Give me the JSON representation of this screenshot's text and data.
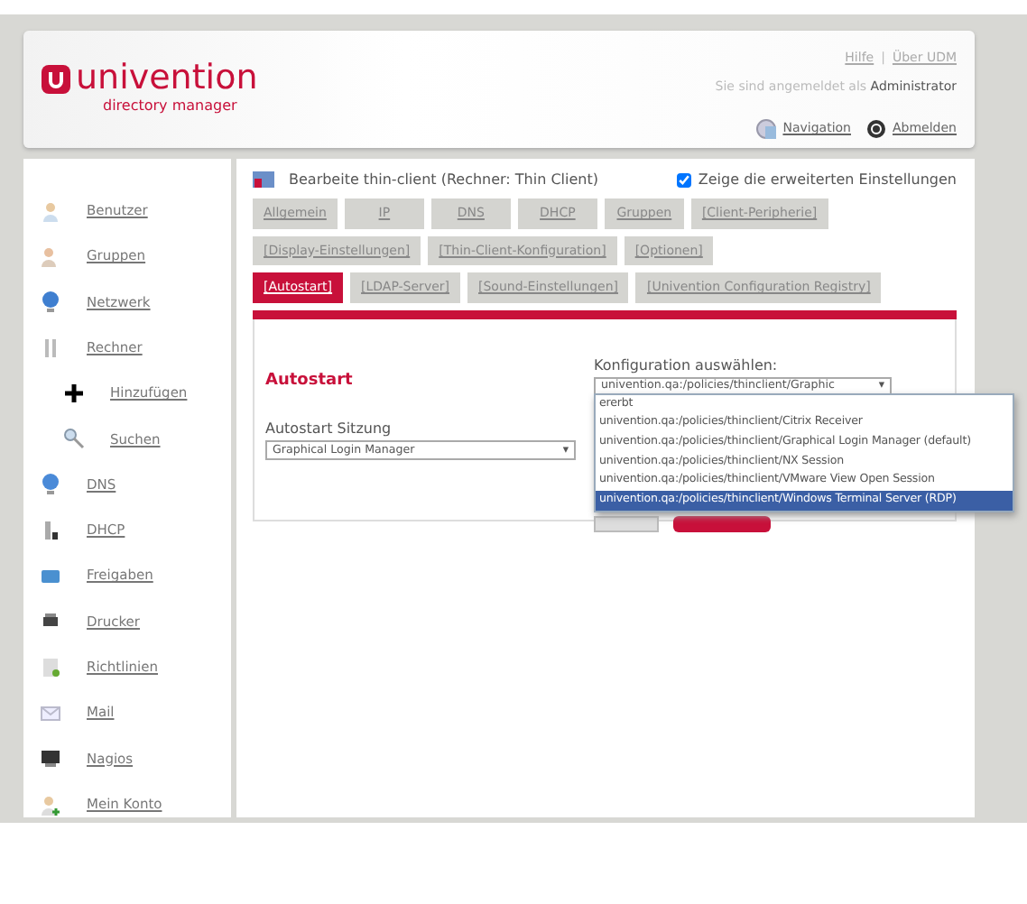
{
  "header": {
    "logo_name": "univention",
    "logo_sub": "directory manager",
    "top_links": [
      "Hilfe",
      "Über UDM"
    ],
    "separator": "|",
    "caret": "▾",
    "login_text": "Sie sind angemeldet als **Administrator**",
    "nav_links": [
      "Navigation",
      "Abmelden"
    ]
  },
  "sidebar": {
    "items": [
      {
        "label": "Benutzer"
      },
      {
        "label": "Gruppen"
      },
      {
        "label": "Netzwerk"
      },
      {
        "label": "Rechner",
        "children": [
          {
            "label": "Hinzufügen"
          },
          {
            "label": "Suchen"
          }
        ]
      },
      {
        "label": "DNS"
      },
      {
        "label": "DHCP"
      },
      {
        "label": "Freigaben"
      },
      {
        "label": "Drucker"
      },
      {
        "label": "Richtlinien"
      },
      {
        "label": "Mail"
      },
      {
        "label": "Nagios"
      },
      {
        "label": "Mein Konto"
      }
    ]
  },
  "form": {
    "title": "Bearbeite thin-client (Rechner: Thin Client)",
    "advanced": {
      "label": "Zeige die erweiterten Einstellungen",
      "checked": true
    },
    "tab_rows": [
      [
        {
          "label": "Allgemein",
          "selected": false
        },
        {
          "label": "IP",
          "selected": false
        },
        {
          "label": "DNS",
          "selected": false
        },
        {
          "label": "DHCP",
          "selected": false
        },
        {
          "label": "Gruppen",
          "selected": false
        },
        {
          "label": "[Client-Peripherie]",
          "selected": false
        }
      ],
      [
        {
          "label": "[Display-Einstellungen]",
          "selected": false
        },
        {
          "label": "[Thin-Client-Konfiguration]",
          "selected": false
        },
        {
          "label": "[Optionen]",
          "selected": false
        }
      ],
      [
        {
          "label": "[Autostart]",
          "selected": true
        },
        {
          "label": "[LDAP-Server]",
          "selected": false
        },
        {
          "label": "[Sound-Einstellungen]",
          "selected": false
        },
        {
          "label": "[Univention Configuration Registry]",
          "selected": false
        }
      ]
    ],
    "section_title": "Autostart",
    "session": {
      "label": "Autostart Sitzung",
      "value": "Graphical Login Manager"
    },
    "config": {
      "label": "Konfiguration auswählen:",
      "value": "univention.qa:/policies/thinclient/Graphic",
      "options": [
        {
          "label": "ererbt",
          "selected": false
        },
        {
          "label": "univention.qa:/policies/thinclient/Citrix Receiver",
          "selected": false
        },
        {
          "label": "univention.qa:/policies/thinclient/Graphical Login Manager (default)",
          "selected": false
        },
        {
          "label": "univention.qa:/policies/thinclient/NX Session",
          "selected": false
        },
        {
          "label": "univention.qa:/policies/thinclient/VMware View Open Session",
          "selected": false
        },
        {
          "label": "univention.qa:/policies/thinclient/Windows Terminal Server (RDP)",
          "selected": true
        }
      ]
    }
  }
}
